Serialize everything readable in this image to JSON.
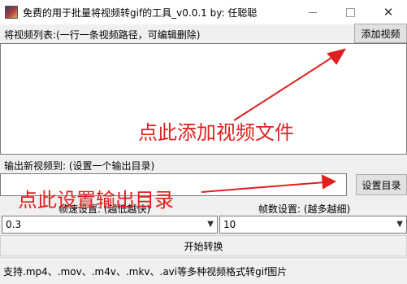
{
  "window": {
    "title": "免费的用于批量将视频转gif的工具_v0.0.1    by: 任聪聪",
    "close_glyph": "✕"
  },
  "video_list": {
    "label": "将视频列表:(一行一条视频路径，可编辑删除)",
    "add_button": "添加视频",
    "content": ""
  },
  "output": {
    "label": "输出新视频到: (设置一个输出目录)",
    "set_button": "设置目录",
    "path_value": ""
  },
  "settings": {
    "speed_label": "帧速设置: (越低越快)",
    "speed_value": "0.3",
    "frames_label": "帧数设置: (越多越细)",
    "frames_value": "10"
  },
  "start_button": "开始转换",
  "status_text": "支持.mp4、.mov、.m4v、.mkv、.avi等多种视频格式转gif图片",
  "annotations": {
    "add_video": "点此添加视频文件",
    "set_output": "点此设置输出目录",
    "color": "#e02020"
  }
}
